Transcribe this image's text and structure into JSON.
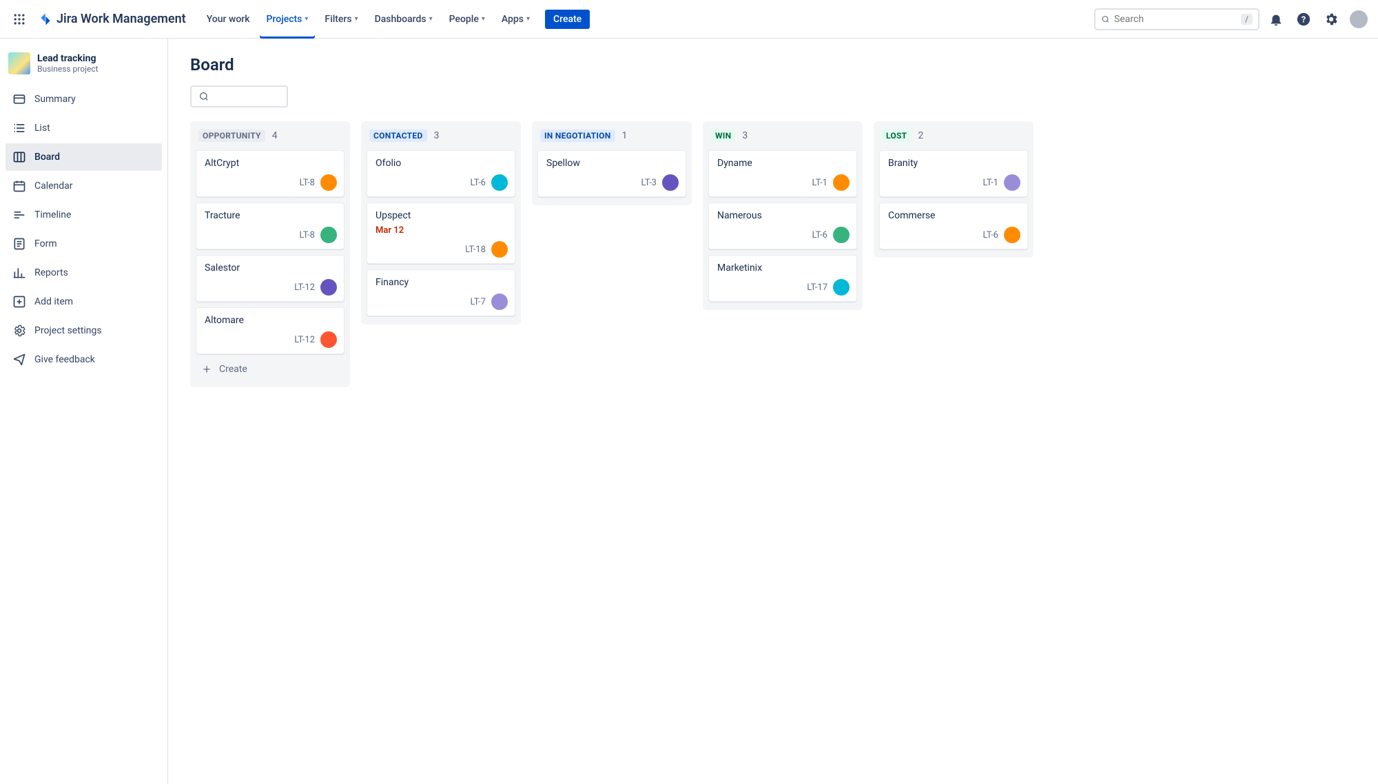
{
  "top": {
    "product": "Jira Work Management",
    "items": [
      {
        "label": "Your work",
        "dropdown": false,
        "active": false
      },
      {
        "label": "Projects",
        "dropdown": true,
        "active": true
      },
      {
        "label": "Filters",
        "dropdown": true,
        "active": false
      },
      {
        "label": "Dashboards",
        "dropdown": true,
        "active": false
      },
      {
        "label": "People",
        "dropdown": true,
        "active": false
      },
      {
        "label": "Apps",
        "dropdown": true,
        "active": false
      }
    ],
    "create": "Create",
    "search_placeholder": "Search",
    "search_key": "/"
  },
  "project": {
    "name": "Lead tracking",
    "type": "Business project"
  },
  "sidebar": {
    "items": [
      {
        "id": "summary",
        "label": "Summary",
        "icon": "card"
      },
      {
        "id": "list",
        "label": "List",
        "icon": "list"
      },
      {
        "id": "board",
        "label": "Board",
        "icon": "board",
        "active": true
      },
      {
        "id": "calendar",
        "label": "Calendar",
        "icon": "calendar"
      },
      {
        "id": "timeline",
        "label": "Timeline",
        "icon": "timeline"
      },
      {
        "id": "form",
        "label": "Form",
        "icon": "form"
      },
      {
        "id": "reports",
        "label": "Reports",
        "icon": "reports"
      },
      {
        "id": "add",
        "label": "Add item",
        "icon": "add"
      },
      {
        "id": "settings",
        "label": "Project settings",
        "icon": "settings"
      },
      {
        "id": "feedback",
        "label": "Give feedback",
        "icon": "feedback"
      }
    ]
  },
  "page": {
    "title": "Board",
    "create_label": "Create"
  },
  "avatar_palette": [
    "#FF8B00",
    "#36B37E",
    "#6554C0",
    "#00B8D9",
    "#FF5630",
    "#998DD9"
  ],
  "columns": [
    {
      "name": "OPPORTUNITY",
      "count": 4,
      "pill": "pill-gray",
      "show_create": true,
      "cards": [
        {
          "title": "AltCrypt",
          "key": "LT-8",
          "avatar": 0
        },
        {
          "title": "Tracture",
          "key": "LT-8",
          "avatar": 1
        },
        {
          "title": "Salestor",
          "key": "LT-12",
          "avatar": 2
        },
        {
          "title": "Altomare",
          "key": "LT-12",
          "avatar": 4
        }
      ]
    },
    {
      "name": "CONTACTED",
      "count": 3,
      "pill": "pill-blue",
      "cards": [
        {
          "title": "Ofolio",
          "key": "LT-6",
          "avatar": 3
        },
        {
          "title": "Upspect",
          "key": "LT-18",
          "date": "Mar 12",
          "avatar": 0
        },
        {
          "title": "Financy",
          "key": "LT-7",
          "avatar": 5
        }
      ]
    },
    {
      "name": "IN NEGOTIATION",
      "count": 1,
      "pill": "pill-blue",
      "cards": [
        {
          "title": "Spellow",
          "key": "LT-3",
          "avatar": 2
        }
      ]
    },
    {
      "name": "WIN",
      "count": 3,
      "pill": "pill-green",
      "cards": [
        {
          "title": "Dyname",
          "key": "LT-1",
          "avatar": 0
        },
        {
          "title": "Namerous",
          "key": "LT-6",
          "avatar": 1
        },
        {
          "title": "Marketinix",
          "key": "LT-17",
          "avatar": 3
        }
      ]
    },
    {
      "name": "LOST",
      "count": 2,
      "pill": "pill-green",
      "cards": [
        {
          "title": "Branity",
          "key": "LT-1",
          "avatar": 5
        },
        {
          "title": "Commerse",
          "key": "LT-6",
          "avatar": 0
        }
      ]
    }
  ]
}
